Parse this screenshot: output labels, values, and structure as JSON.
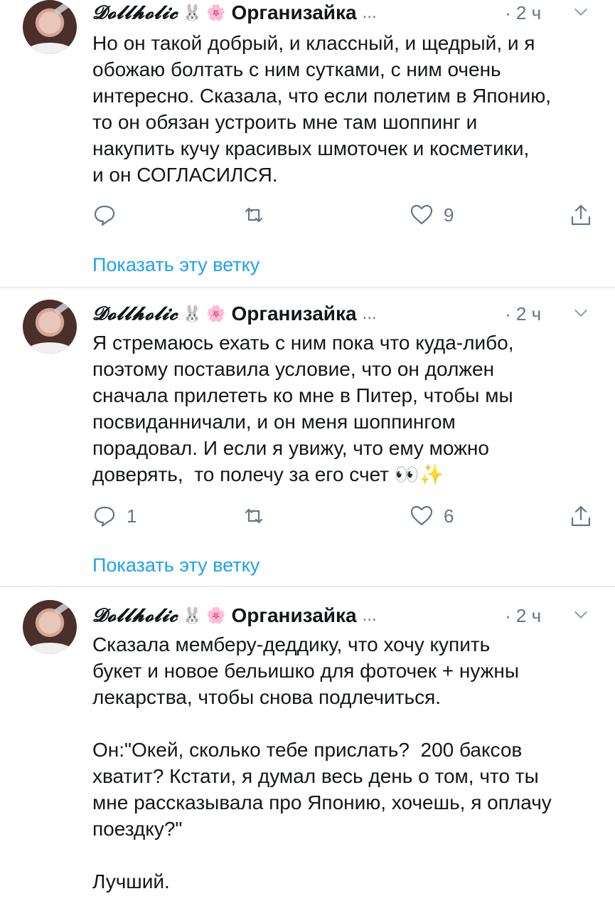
{
  "tweets": [
    {
      "display_name": "𝓓𝓸𝓵𝓵𝓱𝓸𝓵𝓲𝓬",
      "emoji_bunny": "🐰",
      "emoji_flower": "🌸",
      "handle": "Организайка",
      "handle_truncation": "...",
      "time": "· 2 ч",
      "text": "Но он такой добрый, и классный, и щедрый, и я\nобожаю болтать с ним сутками, с ним очень\nинтересно. Сказала, что если полетим в Японию,\nто он обязан устроить мне там шоппинг и\nнакупить кучу красивых шмоточек и косметики,\nи он СОГЛАСИЛСЯ.",
      "reply_count": "",
      "like_count": "9",
      "thread_link": "Показать эту ветку"
    },
    {
      "display_name": "𝓓𝓸𝓵𝓵𝓱𝓸𝓵𝓲𝓬",
      "emoji_bunny": "🐰",
      "emoji_flower": "🌸",
      "handle": "Организайка",
      "handle_truncation": "...",
      "time": "· 2 ч",
      "text": "Я стремаюсь ехать с ним пока что куда-либо,\nпоэтому поставила условие, что он должен\nсначала прилететь ко мне в Питер, чтобы мы\nпосвиданничали, и он меня шоппингом\nпорадовал. И если я увижу, что ему можно\nдоверять,  то полечу за его счет 👀✨",
      "reply_count": "1",
      "like_count": "6",
      "thread_link": "Показать эту ветку"
    },
    {
      "display_name": "𝓓𝓸𝓵𝓵𝓱𝓸𝓵𝓲𝓬",
      "emoji_bunny": "🐰",
      "emoji_flower": "🌸",
      "handle": "Организайка",
      "handle_truncation": "...",
      "time": "· 2 ч",
      "text": "Сказала мемберу-деддику, что хочу купить\nбукет и новое бельишко для фоточек + нужны\nлекарства, чтобы снова подлечиться.\n\nОн:\"Окей, сколько тебе прислать?  200 баксов\nхватит? Кстати, я думал весь день о том, что ты\nмне рассказывала про Японию, хочешь, я оплачу\nпоездку?\"\n\nЛучший."
    }
  ],
  "colors": {
    "link": "#1da1f2",
    "secondary_text": "#657786",
    "divider": "#e6ecf0"
  },
  "icons": [
    "reply-icon",
    "retweet-icon",
    "like-icon",
    "share-icon",
    "caret-down-icon"
  ]
}
